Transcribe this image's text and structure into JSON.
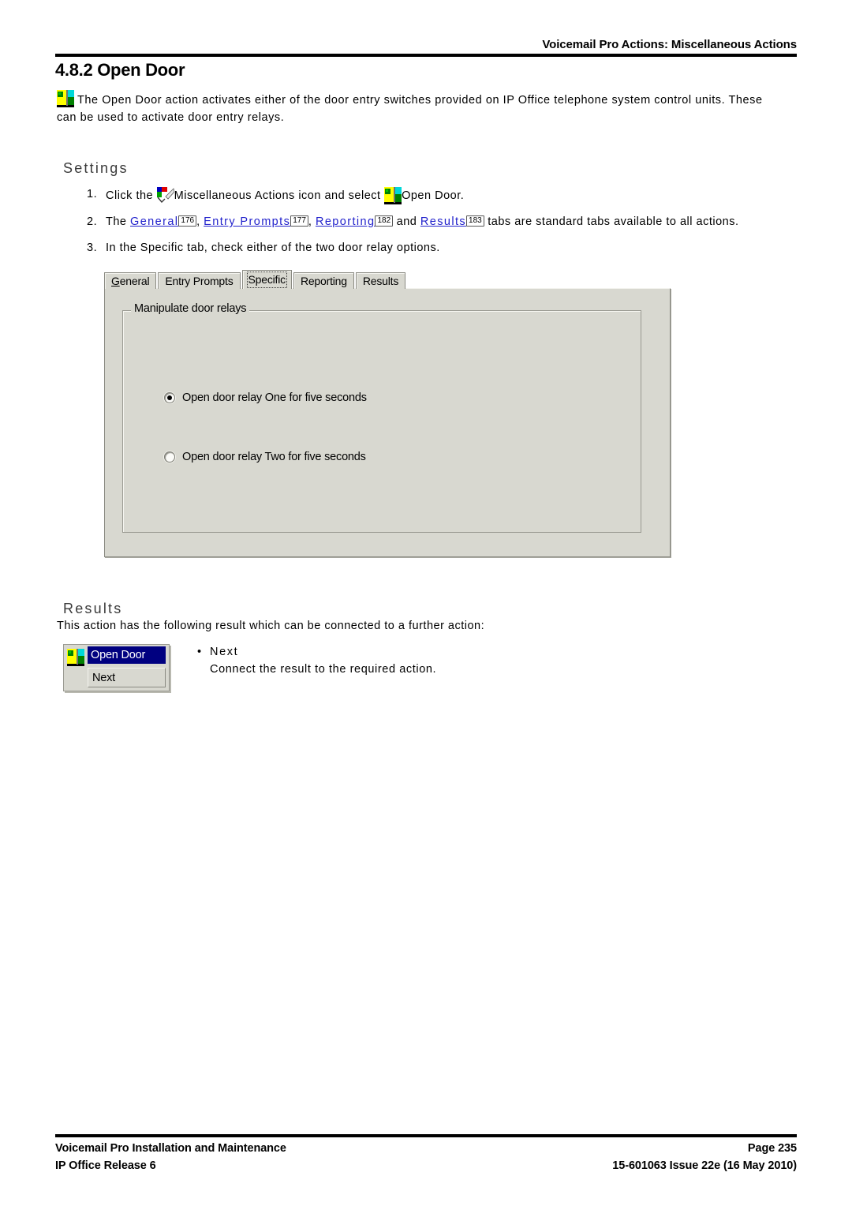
{
  "header": {
    "title": "Voicemail Pro Actions: Miscellaneous Actions"
  },
  "page_title": "4.8.2 Open Door",
  "intro": {
    "icon": "open-door-icon",
    "text": "The Open Door action activates either of the door entry switches provided on IP Office telephone system control units. These can be used to activate door entry relays."
  },
  "settings": {
    "heading": "Settings",
    "steps": [
      {
        "num": "1.",
        "text_before_icon": "Click the ",
        "icon1": "miscellaneous-actions-icon",
        "text_middle": "Miscellaneous Actions icon and select ",
        "icon2": "open-door-icon",
        "text_after": "Open Door."
      },
      {
        "num": "2.",
        "lead": "The ",
        "links": [
          {
            "label": "General",
            "page": "176",
            "sep": ", "
          },
          {
            "label": "Entry Prompts",
            "page": "177",
            "sep": ", "
          },
          {
            "label": "Reporting",
            "page": "182",
            "sep": " and "
          },
          {
            "label": "Results",
            "page": "183",
            "sep": " "
          }
        ],
        "tail": "tabs are standard tabs available to all actions."
      },
      {
        "num": "3.",
        "text": "In the Specific tab, check either of the two door relay options."
      }
    ]
  },
  "dialog": {
    "tabs": [
      {
        "label": "General",
        "accel": "G",
        "active": false
      },
      {
        "label": "Entry Prompts",
        "accel": "",
        "active": false
      },
      {
        "label": "Specific",
        "accel": "",
        "active": true
      },
      {
        "label": "Reporting",
        "accel": "",
        "active": false
      },
      {
        "label": "Results",
        "accel": "",
        "active": false
      }
    ],
    "groupbox_label": "Manipulate door relays",
    "radios": [
      {
        "label": "Open door relay One for five seconds",
        "checked": true
      },
      {
        "label": "Open door relay Two for five seconds",
        "checked": false
      }
    ]
  },
  "results": {
    "heading": "Results",
    "intro": "This action has the following result which can be connected to a further action:",
    "node": {
      "icon": "open-door-icon",
      "title": "Open Door",
      "result": "Next"
    },
    "bullets": [
      {
        "dot": "•",
        "name": "Next",
        "description": "Connect the result to the required action."
      }
    ]
  },
  "footer": {
    "left_line1": "Voicemail Pro Installation and Maintenance",
    "left_line2": "IP Office Release 6",
    "right_line1": "Page 235",
    "right_line2": "15-601063 Issue 22e (16 May 2010)"
  },
  "colors": {
    "link": "#2222cc",
    "dialog_face": "#d8d8d0",
    "node_title_bar": "#000080",
    "rule": "#000000"
  }
}
